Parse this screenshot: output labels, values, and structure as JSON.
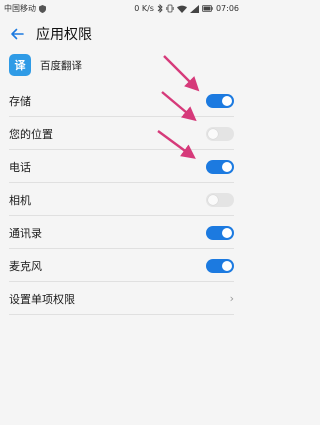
{
  "status_bar": {
    "carrier": "中国移动",
    "net_speed": "0 K/s",
    "battery_percent": "",
    "time": "07:06",
    "icons": [
      "shield-icon",
      "bluetooth-icon",
      "vibrate-icon",
      "wifi-icon",
      "signal-icon",
      "battery-icon"
    ]
  },
  "header": {
    "back_icon": "arrow-left-icon",
    "title": "应用权限"
  },
  "app": {
    "name": "百度翻译",
    "icon_glyph": "译",
    "icon_color": "#2f9be6"
  },
  "permissions": [
    {
      "label": "存储",
      "enabled": true
    },
    {
      "label": "您的位置",
      "enabled": false
    },
    {
      "label": "电话",
      "enabled": true
    },
    {
      "label": "相机",
      "enabled": false
    },
    {
      "label": "通讯录",
      "enabled": true
    },
    {
      "label": "麦克风",
      "enabled": true
    }
  ],
  "settings_row": {
    "label": "设置单项权限",
    "chevron": "›"
  },
  "colors": {
    "toggle_on": "#1c7ae0",
    "toggle_off": "#e4e4e4",
    "annotation_arrow": "#d63a7a",
    "background": "#f5f5f5"
  }
}
